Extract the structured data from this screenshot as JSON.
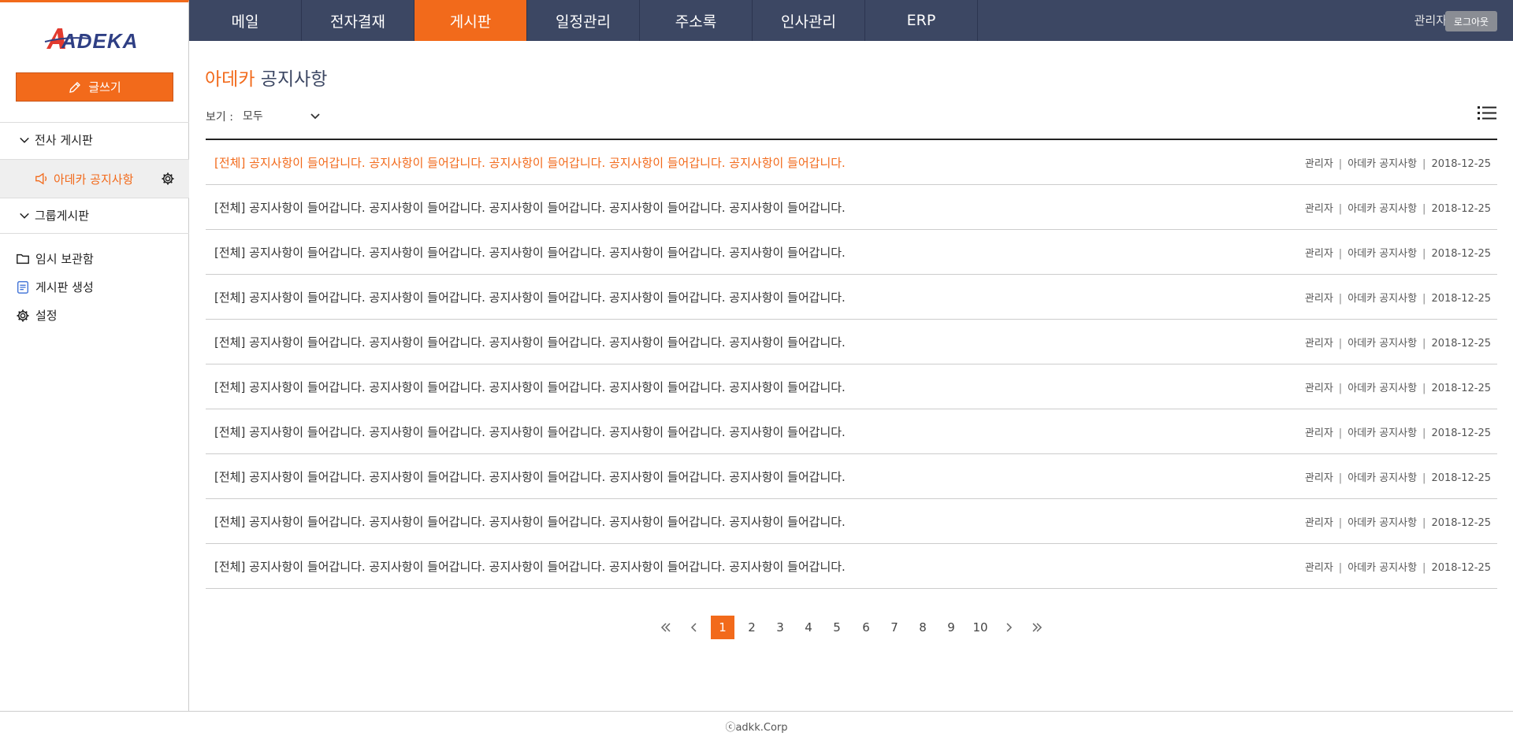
{
  "logo": {
    "brand": "ADEKA"
  },
  "sidebar": {
    "write_label": "글쓰기",
    "section_company": "전사 게시판",
    "active_board": "아데카 공지사항",
    "section_group": "그룹게시판",
    "links": [
      {
        "label": "임시 보관함",
        "icon": "folder-icon"
      },
      {
        "label": "게시판 생성",
        "icon": "board-create-icon"
      },
      {
        "label": "설정",
        "icon": "gear-icon"
      }
    ]
  },
  "nav": {
    "items": [
      "메일",
      "전자결재",
      "게시판",
      "일정관리",
      "주소록",
      "인사관리",
      "ERP"
    ],
    "active": "게시판",
    "user": "관리자",
    "logout": "로그아웃"
  },
  "main": {
    "title_accent": "아데카",
    "title_rest": "공지사항",
    "view_label": "보기 :",
    "view_value": "모두",
    "rows": [
      {
        "title": "[전체] 공지사항이 들어갑니다. 공지사항이 들어갑니다. 공지사항이 들어갑니다. 공지사항이 들어갑니다. 공지사항이 들어갑니다.",
        "author": "관리자",
        "board": "아데카 공지사항",
        "date": "2018-12-25",
        "highlight": true
      },
      {
        "title": "[전체] 공지사항이 들어갑니다. 공지사항이 들어갑니다. 공지사항이 들어갑니다. 공지사항이 들어갑니다. 공지사항이 들어갑니다.",
        "author": "관리자",
        "board": "아데카 공지사항",
        "date": "2018-12-25"
      },
      {
        "title": "[전체] 공지사항이 들어갑니다. 공지사항이 들어갑니다. 공지사항이 들어갑니다. 공지사항이 들어갑니다. 공지사항이 들어갑니다.",
        "author": "관리자",
        "board": "아데카 공지사항",
        "date": "2018-12-25"
      },
      {
        "title": "[전체] 공지사항이 들어갑니다. 공지사항이 들어갑니다. 공지사항이 들어갑니다. 공지사항이 들어갑니다. 공지사항이 들어갑니다.",
        "author": "관리자",
        "board": "아데카 공지사항",
        "date": "2018-12-25"
      },
      {
        "title": "[전체] 공지사항이 들어갑니다. 공지사항이 들어갑니다. 공지사항이 들어갑니다. 공지사항이 들어갑니다. 공지사항이 들어갑니다.",
        "author": "관리자",
        "board": "아데카 공지사항",
        "date": "2018-12-25"
      },
      {
        "title": "[전체] 공지사항이 들어갑니다. 공지사항이 들어갑니다. 공지사항이 들어갑니다. 공지사항이 들어갑니다. 공지사항이 들어갑니다.",
        "author": "관리자",
        "board": "아데카 공지사항",
        "date": "2018-12-25"
      },
      {
        "title": "[전체] 공지사항이 들어갑니다. 공지사항이 들어갑니다. 공지사항이 들어갑니다. 공지사항이 들어갑니다. 공지사항이 들어갑니다.",
        "author": "관리자",
        "board": "아데카 공지사항",
        "date": "2018-12-25"
      },
      {
        "title": "[전체] 공지사항이 들어갑니다. 공지사항이 들어갑니다. 공지사항이 들어갑니다. 공지사항이 들어갑니다. 공지사항이 들어갑니다.",
        "author": "관리자",
        "board": "아데카 공지사항",
        "date": "2018-12-25"
      },
      {
        "title": "[전체] 공지사항이 들어갑니다. 공지사항이 들어갑니다. 공지사항이 들어갑니다. 공지사항이 들어갑니다. 공지사항이 들어갑니다.",
        "author": "관리자",
        "board": "아데카 공지사항",
        "date": "2018-12-25"
      },
      {
        "title": "[전체] 공지사항이 들어갑니다. 공지사항이 들어갑니다. 공지사항이 들어갑니다. 공지사항이 들어갑니다. 공지사항이 들어갑니다.",
        "author": "관리자",
        "board": "아데카 공지사항",
        "date": "2018-12-25"
      }
    ]
  },
  "pagination": {
    "pages": [
      "1",
      "2",
      "3",
      "4",
      "5",
      "6",
      "7",
      "8",
      "9",
      "10"
    ],
    "current": "1"
  },
  "footer": {
    "text": "ⓒadkk.Corp"
  },
  "colors": {
    "accent": "#f26a1b",
    "nav_bg": "#3c4763"
  }
}
